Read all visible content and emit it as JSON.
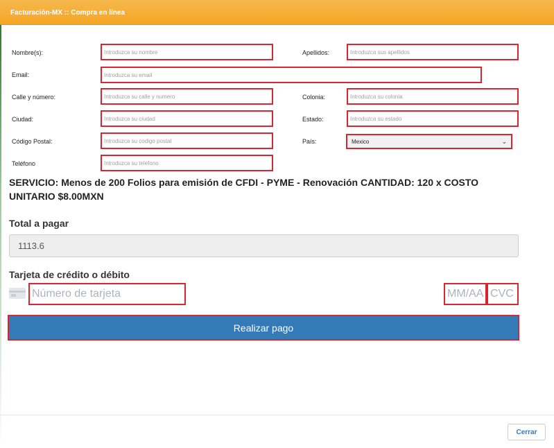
{
  "header": {
    "title": "Facturación-MX :: Compra en línea"
  },
  "form": {
    "nombre": {
      "label": "Nombre(s):",
      "placeholder": "Introduzca su nombre"
    },
    "apellidos": {
      "label": "Apellidos:",
      "placeholder": "Introduzca sus apellidos"
    },
    "email": {
      "label": "Email:",
      "placeholder": "Introduzca su email"
    },
    "calle": {
      "label": "Calle y número:",
      "placeholder": "Introduzca su calle y numero"
    },
    "colonia": {
      "label": "Colonia:",
      "placeholder": "Introduzca su colonia"
    },
    "ciudad": {
      "label": "Ciudad:",
      "placeholder": "Introduzca su ciudad"
    },
    "estado": {
      "label": "Estado:",
      "placeholder": "Introduzca su estado"
    },
    "cp": {
      "label": "Código Postal:",
      "placeholder": "Introduzca su codigo postal"
    },
    "pais": {
      "label": "País:",
      "selected": "Mexico"
    },
    "telefono": {
      "label": "Teléfono",
      "placeholder": "Introduzca su telefono"
    }
  },
  "service": {
    "text": "SERVICIO: Menos de 200 Folios para emisión de CFDI - PYME - Renovación CANTIDAD: 120 x COSTO UNITARIO $8.00MXN"
  },
  "total": {
    "label": "Total a pagar",
    "value": "1113.6"
  },
  "card": {
    "label": "Tarjeta de crédito o débito",
    "number_placeholder": "Número de tarjeta",
    "expiry_placeholder": "MM/AA",
    "cvc_placeholder": "CVC"
  },
  "actions": {
    "pay_label": "Realizar pago",
    "close_label": "Cerrar"
  },
  "colors": {
    "header": "#f5a623",
    "highlight": "#d9252f",
    "primary": "#337ab7"
  }
}
